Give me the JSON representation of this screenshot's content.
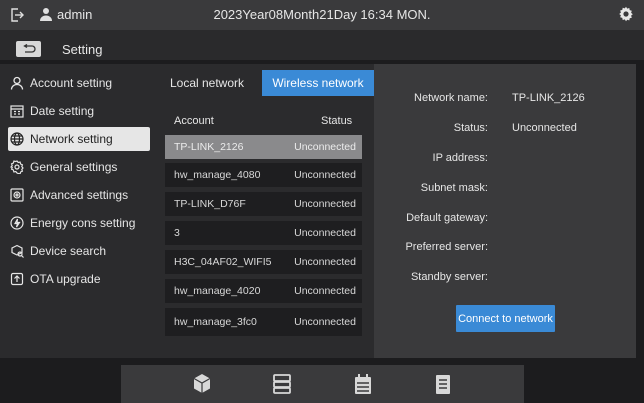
{
  "topbar": {
    "username": "admin",
    "datetime": "2023Year08Month21Day 16:34 MON."
  },
  "titlebar": {
    "title": "Setting"
  },
  "sidebar": {
    "items": [
      {
        "label": "Account setting",
        "icon": "user-icon"
      },
      {
        "label": "Date setting",
        "icon": "calendar-icon"
      },
      {
        "label": "Network setting",
        "icon": "globe-icon",
        "active": true
      },
      {
        "label": "General settings",
        "icon": "settings-icon"
      },
      {
        "label": "Advanced settings",
        "icon": "advanced-icon"
      },
      {
        "label": "Energy cons setting",
        "icon": "energy-icon"
      },
      {
        "label": "Device search",
        "icon": "device-search-icon"
      },
      {
        "label": "OTA upgrade",
        "icon": "upgrade-icon"
      }
    ]
  },
  "tabs": {
    "local": "Local network",
    "wireless": "Wireless network"
  },
  "list": {
    "col_account": "Account",
    "col_status": "Status",
    "rows": [
      {
        "account": "TP-LINK_2126",
        "status": "Unconnected"
      },
      {
        "account": "hw_manage_4080",
        "status": "Unconnected"
      },
      {
        "account": "TP-LINK_D76F",
        "status": "Unconnected"
      },
      {
        "account": "3",
        "status": "Unconnected"
      },
      {
        "account": "H3C_04AF02_WIFI5",
        "status": "Unconnected"
      },
      {
        "account": "hw_manage_4020",
        "status": "Unconnected"
      },
      {
        "account": "hw_manage_3fc0",
        "status": "Unconnected"
      }
    ]
  },
  "details": {
    "network_name_label": "Network name:",
    "network_name_value": "TP-LINK_2126",
    "status_label": "Status:",
    "status_value": "Unconnected",
    "ip_label": "IP address:",
    "subnet_label": "Subnet mask:",
    "gateway_label": "Default gateway:",
    "preferred_label": "Preferred server:",
    "standby_label": "Standby server:",
    "connect_button": "Connect to network"
  },
  "colors": {
    "accent": "#3a8ad6"
  }
}
